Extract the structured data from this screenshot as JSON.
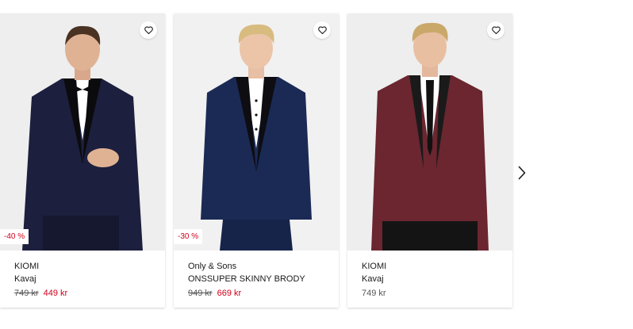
{
  "products": [
    {
      "brand": "KIOMI",
      "name": "Kavaj",
      "old_price": "749 kr",
      "price": "449 kr",
      "discount": "-40 %",
      "jacket_color": "#1c1f3d",
      "lapel_color": "#0b0b0d"
    },
    {
      "brand": "Only & Sons",
      "name": "ONSSUPER SKINNY BRODY",
      "old_price": "949 kr",
      "price": "669 kr",
      "discount": "-30 %",
      "jacket_color": "#1b2a55",
      "lapel_color": "#0d0d12"
    },
    {
      "brand": "KIOMI",
      "name": "Kavaj",
      "price": "749 kr",
      "jacket_color": "#6b2630",
      "lapel_color": "#1a1a1a"
    }
  ],
  "icons": {
    "wishlist": "heart-outline-icon",
    "next": "chevron-right-icon"
  },
  "colors": {
    "sale": "#d0021b",
    "text": "#1a1a1a",
    "muted": "#555555"
  }
}
